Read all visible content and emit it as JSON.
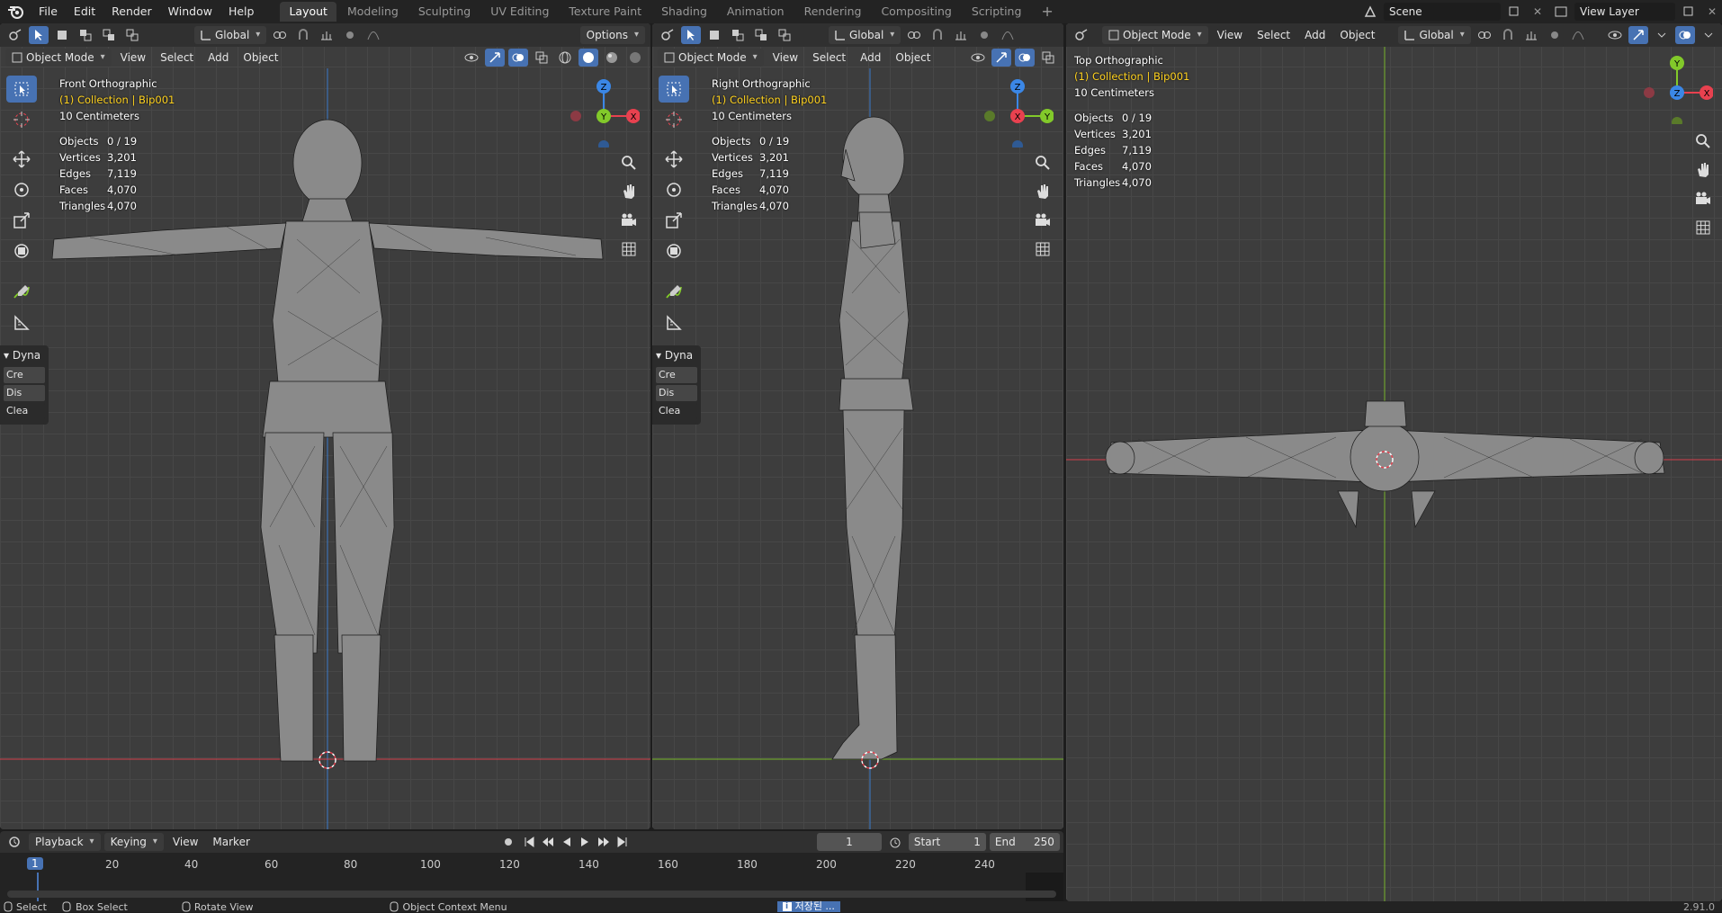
{
  "menu": {
    "file": "File",
    "edit": "Edit",
    "render": "Render",
    "window": "Window",
    "help": "Help"
  },
  "workspaces": [
    "Layout",
    "Modeling",
    "Sculpting",
    "UV Editing",
    "Texture Paint",
    "Shading",
    "Animation",
    "Rendering",
    "Compositing",
    "Scripting"
  ],
  "add_workspace": "+",
  "scene": {
    "name": "Scene",
    "view_layer": "View Layer"
  },
  "viewport_front": {
    "transform": "Global",
    "options": "Options",
    "mode": "Object Mode",
    "menus": [
      "View",
      "Select",
      "Add",
      "Object"
    ],
    "view_name": "Front Orthographic",
    "collection": "(1) Collection | Bip001",
    "scale": "10 Centimeters",
    "stats": [
      [
        "Objects",
        "0 / 19"
      ],
      [
        "Vertices",
        "3,201"
      ],
      [
        "Edges",
        "7,119"
      ],
      [
        "Faces",
        "4,070"
      ],
      [
        "Triangles",
        "4,070"
      ]
    ],
    "panel": {
      "title": "Dyna",
      "items": [
        "Cre",
        "Dis",
        "Clea"
      ]
    },
    "gizmo": {
      "up": "Z",
      "center": "Y",
      "right": "X"
    }
  },
  "viewport_right": {
    "transform": "Global",
    "mode": "Object Mode",
    "menus": [
      "View",
      "Select",
      "Add",
      "Object"
    ],
    "view_name": "Right Orthographic",
    "collection": "(1) Collection | Bip001",
    "scale": "10 Centimeters",
    "stats": [
      [
        "Objects",
        "0 / 19"
      ],
      [
        "Vertices",
        "3,201"
      ],
      [
        "Edges",
        "7,119"
      ],
      [
        "Faces",
        "4,070"
      ],
      [
        "Triangles",
        "4,070"
      ]
    ],
    "panel": {
      "title": "Dyna",
      "items": [
        "Cre",
        "Dis",
        "Clea"
      ]
    },
    "gizmo": {
      "up": "Z",
      "center": "X",
      "right": "Y"
    }
  },
  "viewport_top": {
    "transform": "Global",
    "mode": "Object Mode",
    "menus": [
      "View",
      "Select",
      "Add",
      "Object"
    ],
    "view_name": "Top Orthographic",
    "collection": "(1) Collection | Bip001",
    "scale": "10 Centimeters",
    "stats": [
      [
        "Objects",
        "0 / 19"
      ],
      [
        "Vertices",
        "3,201"
      ],
      [
        "Edges",
        "7,119"
      ],
      [
        "Faces",
        "4,070"
      ],
      [
        "Triangles",
        "4,070"
      ]
    ],
    "gizmo": {
      "up": "Y",
      "center": "Z",
      "right": "X"
    }
  },
  "timeline": {
    "menus": [
      "Playback",
      "Keying",
      "View",
      "Marker"
    ],
    "current_frame": "1",
    "start_label": "Start",
    "start": "1",
    "end_label": "End",
    "end": "250",
    "ticks": [
      "1",
      "20",
      "40",
      "60",
      "80",
      "100",
      "120",
      "140",
      "160",
      "180",
      "200",
      "220",
      "240"
    ]
  },
  "status": {
    "select": "Select",
    "box_select": "Box Select",
    "rotate_view": "Rotate View",
    "context_menu": "Object Context Menu",
    "notice": "저장된 ...",
    "version": "2.91.0"
  },
  "colors": {
    "accent": "#4772b3",
    "x_axis": "#e8414f",
    "y_axis": "#82c92a",
    "z_axis": "#3b87e6",
    "collection": "#ffd21f"
  }
}
